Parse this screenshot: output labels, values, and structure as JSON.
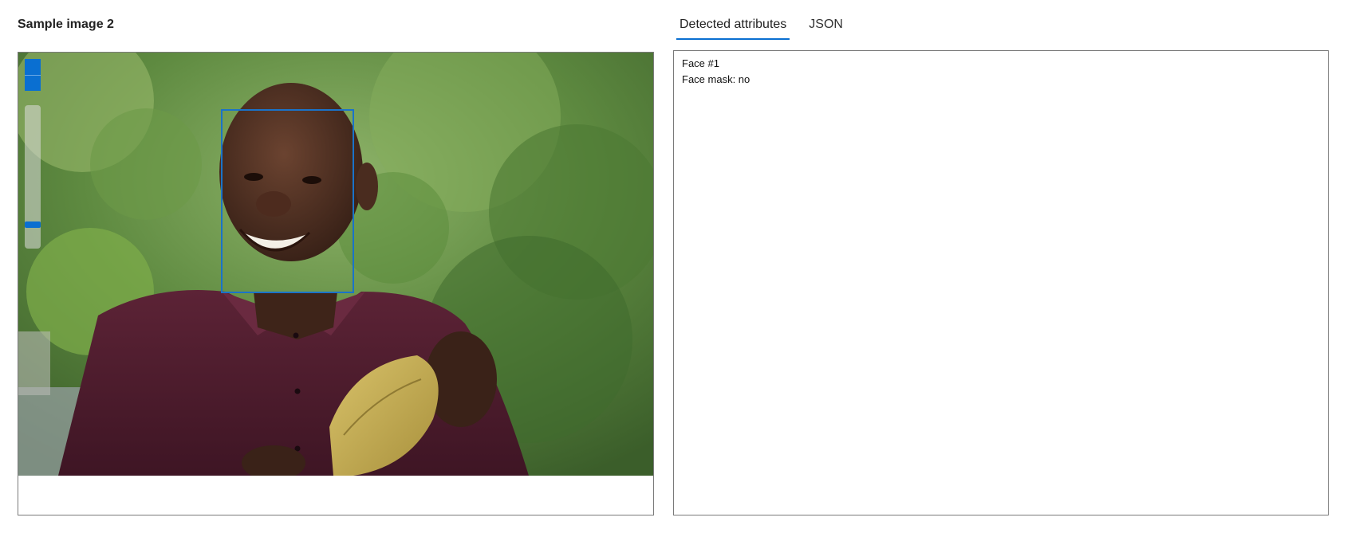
{
  "header": {
    "title": "Sample image 2"
  },
  "viewer": {
    "zoom_in_icon": "zoom-in-icon",
    "zoom_out_icon": "zoom-out-icon",
    "zoom_level": 0.15,
    "colors": {
      "accent": "#0a6fd1",
      "face_box": "#1a73c9"
    }
  },
  "tabs": [
    {
      "label": "Detected attributes",
      "active": true
    },
    {
      "label": "JSON",
      "active": false
    }
  ],
  "results": {
    "face_label": "Face #1",
    "face_mask": "Face mask: no"
  }
}
